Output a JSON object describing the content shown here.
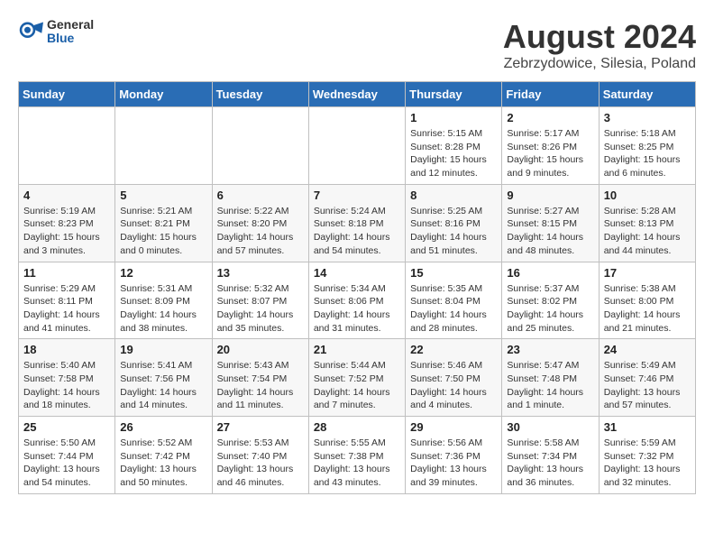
{
  "header": {
    "logo_general": "General",
    "logo_blue": "Blue",
    "month_year": "August 2024",
    "location": "Zebrzydowice, Silesia, Poland"
  },
  "days_of_week": [
    "Sunday",
    "Monday",
    "Tuesday",
    "Wednesday",
    "Thursday",
    "Friday",
    "Saturday"
  ],
  "weeks": [
    [
      {
        "day": "",
        "detail": ""
      },
      {
        "day": "",
        "detail": ""
      },
      {
        "day": "",
        "detail": ""
      },
      {
        "day": "",
        "detail": ""
      },
      {
        "day": "1",
        "detail": "Sunrise: 5:15 AM\nSunset: 8:28 PM\nDaylight: 15 hours\nand 12 minutes."
      },
      {
        "day": "2",
        "detail": "Sunrise: 5:17 AM\nSunset: 8:26 PM\nDaylight: 15 hours\nand 9 minutes."
      },
      {
        "day": "3",
        "detail": "Sunrise: 5:18 AM\nSunset: 8:25 PM\nDaylight: 15 hours\nand 6 minutes."
      }
    ],
    [
      {
        "day": "4",
        "detail": "Sunrise: 5:19 AM\nSunset: 8:23 PM\nDaylight: 15 hours\nand 3 minutes."
      },
      {
        "day": "5",
        "detail": "Sunrise: 5:21 AM\nSunset: 8:21 PM\nDaylight: 15 hours\nand 0 minutes."
      },
      {
        "day": "6",
        "detail": "Sunrise: 5:22 AM\nSunset: 8:20 PM\nDaylight: 14 hours\nand 57 minutes."
      },
      {
        "day": "7",
        "detail": "Sunrise: 5:24 AM\nSunset: 8:18 PM\nDaylight: 14 hours\nand 54 minutes."
      },
      {
        "day": "8",
        "detail": "Sunrise: 5:25 AM\nSunset: 8:16 PM\nDaylight: 14 hours\nand 51 minutes."
      },
      {
        "day": "9",
        "detail": "Sunrise: 5:27 AM\nSunset: 8:15 PM\nDaylight: 14 hours\nand 48 minutes."
      },
      {
        "day": "10",
        "detail": "Sunrise: 5:28 AM\nSunset: 8:13 PM\nDaylight: 14 hours\nand 44 minutes."
      }
    ],
    [
      {
        "day": "11",
        "detail": "Sunrise: 5:29 AM\nSunset: 8:11 PM\nDaylight: 14 hours\nand 41 minutes."
      },
      {
        "day": "12",
        "detail": "Sunrise: 5:31 AM\nSunset: 8:09 PM\nDaylight: 14 hours\nand 38 minutes."
      },
      {
        "day": "13",
        "detail": "Sunrise: 5:32 AM\nSunset: 8:07 PM\nDaylight: 14 hours\nand 35 minutes."
      },
      {
        "day": "14",
        "detail": "Sunrise: 5:34 AM\nSunset: 8:06 PM\nDaylight: 14 hours\nand 31 minutes."
      },
      {
        "day": "15",
        "detail": "Sunrise: 5:35 AM\nSunset: 8:04 PM\nDaylight: 14 hours\nand 28 minutes."
      },
      {
        "day": "16",
        "detail": "Sunrise: 5:37 AM\nSunset: 8:02 PM\nDaylight: 14 hours\nand 25 minutes."
      },
      {
        "day": "17",
        "detail": "Sunrise: 5:38 AM\nSunset: 8:00 PM\nDaylight: 14 hours\nand 21 minutes."
      }
    ],
    [
      {
        "day": "18",
        "detail": "Sunrise: 5:40 AM\nSunset: 7:58 PM\nDaylight: 14 hours\nand 18 minutes."
      },
      {
        "day": "19",
        "detail": "Sunrise: 5:41 AM\nSunset: 7:56 PM\nDaylight: 14 hours\nand 14 minutes."
      },
      {
        "day": "20",
        "detail": "Sunrise: 5:43 AM\nSunset: 7:54 PM\nDaylight: 14 hours\nand 11 minutes."
      },
      {
        "day": "21",
        "detail": "Sunrise: 5:44 AM\nSunset: 7:52 PM\nDaylight: 14 hours\nand 7 minutes."
      },
      {
        "day": "22",
        "detail": "Sunrise: 5:46 AM\nSunset: 7:50 PM\nDaylight: 14 hours\nand 4 minutes."
      },
      {
        "day": "23",
        "detail": "Sunrise: 5:47 AM\nSunset: 7:48 PM\nDaylight: 14 hours\nand 1 minute."
      },
      {
        "day": "24",
        "detail": "Sunrise: 5:49 AM\nSunset: 7:46 PM\nDaylight: 13 hours\nand 57 minutes."
      }
    ],
    [
      {
        "day": "25",
        "detail": "Sunrise: 5:50 AM\nSunset: 7:44 PM\nDaylight: 13 hours\nand 54 minutes."
      },
      {
        "day": "26",
        "detail": "Sunrise: 5:52 AM\nSunset: 7:42 PM\nDaylight: 13 hours\nand 50 minutes."
      },
      {
        "day": "27",
        "detail": "Sunrise: 5:53 AM\nSunset: 7:40 PM\nDaylight: 13 hours\nand 46 minutes."
      },
      {
        "day": "28",
        "detail": "Sunrise: 5:55 AM\nSunset: 7:38 PM\nDaylight: 13 hours\nand 43 minutes."
      },
      {
        "day": "29",
        "detail": "Sunrise: 5:56 AM\nSunset: 7:36 PM\nDaylight: 13 hours\nand 39 minutes."
      },
      {
        "day": "30",
        "detail": "Sunrise: 5:58 AM\nSunset: 7:34 PM\nDaylight: 13 hours\nand 36 minutes."
      },
      {
        "day": "31",
        "detail": "Sunrise: 5:59 AM\nSunset: 7:32 PM\nDaylight: 13 hours\nand 32 minutes."
      }
    ]
  ]
}
